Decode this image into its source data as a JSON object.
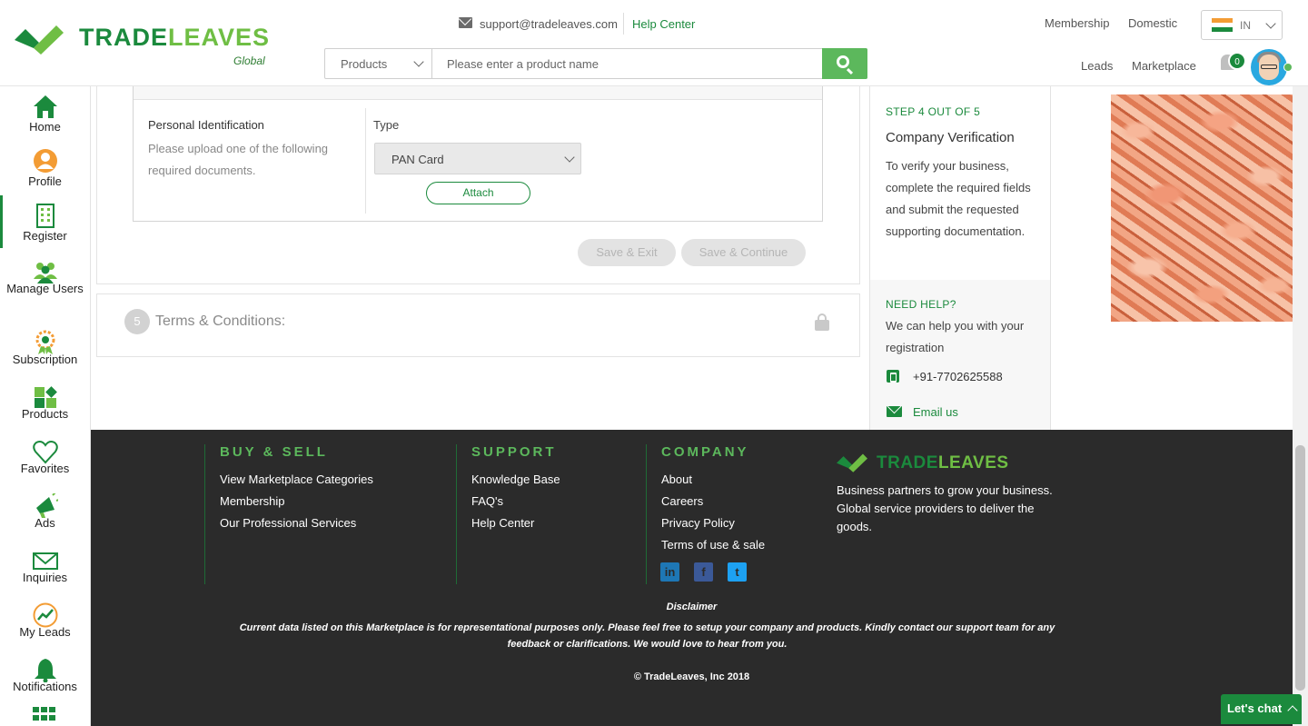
{
  "header": {
    "logo_main": "TRADE",
    "logo_accent": "LEAVES",
    "logo_sub": "Global",
    "support_email": "support@tradeleaves.com",
    "help_center": "Help Center",
    "search": {
      "category": "Products",
      "placeholder": "Please enter a product name"
    },
    "links": {
      "membership": "Membership",
      "domestic": "Domestic",
      "leads": "Leads",
      "marketplace": "Marketplace"
    },
    "country": "IN",
    "notification_count": "0"
  },
  "sidebar": {
    "items": [
      {
        "label": "Home",
        "icon": "home-icon"
      },
      {
        "label": "Profile",
        "icon": "profile-icon"
      },
      {
        "label": "Register",
        "icon": "building-icon",
        "active": true
      },
      {
        "label": "Manage Users",
        "icon": "users-icon"
      },
      {
        "label": "Subscription",
        "icon": "award-icon"
      },
      {
        "label": "Products",
        "icon": "products-icon"
      },
      {
        "label": "Favorites",
        "icon": "heart-icon"
      },
      {
        "label": "Ads",
        "icon": "megaphone-icon"
      },
      {
        "label": "Inquiries",
        "icon": "envelope-icon"
      },
      {
        "label": "My Leads",
        "icon": "leads-icon"
      },
      {
        "label": "Notifications",
        "icon": "bell-icon"
      }
    ]
  },
  "form": {
    "section_title": "Personal Identification",
    "section_desc": "Please upload one of the following required documents.",
    "type_label": "Type",
    "type_value": "PAN Card",
    "attach": "Attach",
    "save_exit": "Save & Exit",
    "save_continue": "Save & Continue",
    "next_step_number": "5",
    "next_step_title": "Terms & Conditions:"
  },
  "right_panel": {
    "step": "STEP 4 OUT OF 5",
    "title": "Company Verification",
    "desc": "To verify your business, complete the required fields and submit the requested supporting documentation.",
    "help_title": "NEED HELP?",
    "help_desc": "We can help you with your registration",
    "phone": "+91-7702625588",
    "email": "Email us"
  },
  "footer": {
    "buy_sell": {
      "title": "BUY & SELL",
      "links": [
        "View Marketplace Categories",
        "Membership",
        "Our Professional Services"
      ]
    },
    "support": {
      "title": "SUPPORT",
      "links": [
        "Knowledge Base",
        "FAQ's",
        "Help Center"
      ]
    },
    "company": {
      "title": "COMPANY",
      "links": [
        "About",
        "Careers",
        "Privacy Policy",
        "Terms of use & sale"
      ]
    },
    "social": [
      "linkedin-icon",
      "facebook-icon",
      "twitter-icon"
    ],
    "logo_main": "TRADE",
    "logo_accent": "LEAVES",
    "tagline": "Business partners to grow your business. Global service providers to deliver the goods.",
    "disclaimer_title": "Disclaimer",
    "disclaimer": "Current data listed on this Marketplace is for representational purposes only. Please feel free to setup your company and products. Kindly contact our support team for any feedback or clarifications. We would love to hear from you.",
    "copyright": "© TradeLeaves, Inc 2018"
  },
  "chat": {
    "label": "Let's chat"
  },
  "colors": {
    "brand_dark": "#1b8a3d",
    "brand_light": "#6fbe44",
    "search_button": "#5cb85c",
    "footer_bg": "#2b2b2b"
  }
}
